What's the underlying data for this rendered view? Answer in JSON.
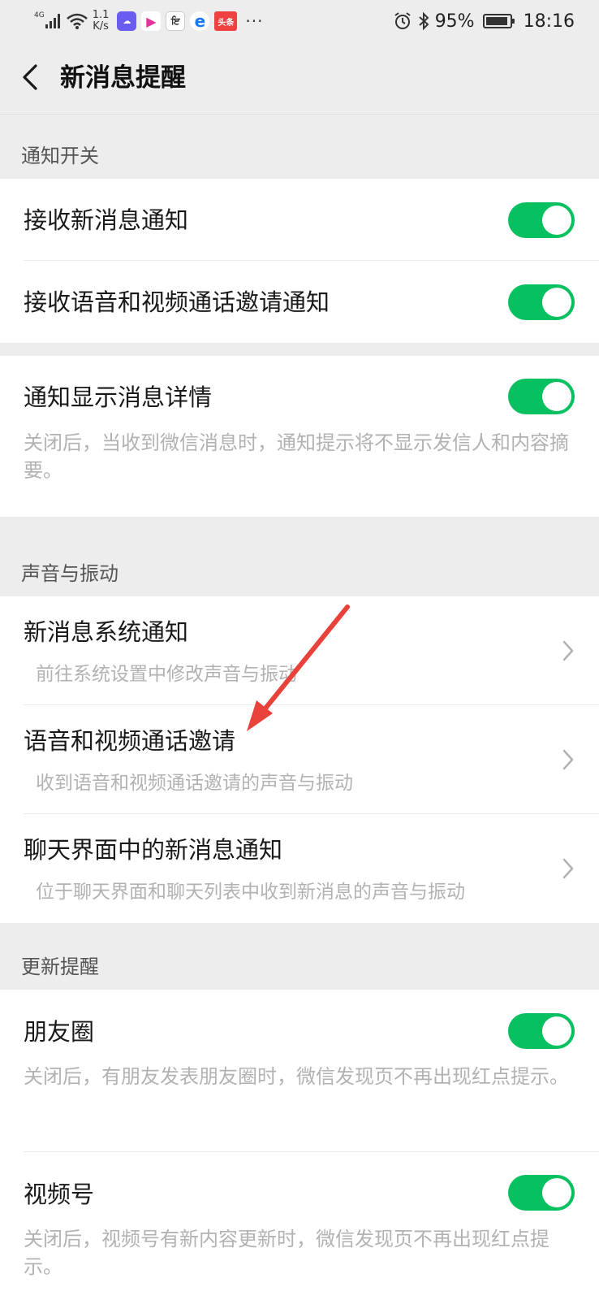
{
  "status_bar": {
    "network": "4G",
    "speed_value": "1.1",
    "speed_unit": "K/s",
    "app_icons": [
      {
        "name": "app-icon-cloud",
        "color": "#6a5cf0",
        "glyph": "☁"
      },
      {
        "name": "app-icon-play",
        "color": "#ffffff",
        "glyph": "▶"
      },
      {
        "name": "app-icon-news",
        "color": "#ffffff",
        "glyph": "ਇ"
      },
      {
        "name": "app-icon-browser",
        "color": "#1677ff",
        "glyph": "e"
      },
      {
        "name": "app-icon-toutiao",
        "color": "#f04142",
        "glyph": "头条"
      }
    ],
    "more": "···",
    "battery_percent": "95%",
    "battery_level": 0.95,
    "time": "18:16"
  },
  "navbar": {
    "title": "新消息提醒"
  },
  "sections": {
    "notify_switch": "通知开关",
    "sound_vibration": "声音与振动",
    "update_remind": "更新提醒"
  },
  "rows": {
    "receive_new": {
      "label": "接收新消息通知",
      "on": true
    },
    "receive_call": {
      "label": "接收语音和视频通话邀请通知",
      "on": true
    },
    "show_detail": {
      "label": "通知显示消息详情",
      "on": true,
      "desc": "关闭后，当收到微信消息时，通知提示将不显示发信人和内容摘要。"
    },
    "system_notify": {
      "label": "新消息系统通知",
      "desc": "前往系统设置中修改声音与振动"
    },
    "call_invite": {
      "label": "语音和视频通话邀请",
      "desc": "收到语音和视频通话邀请的声音与振动"
    },
    "chat_notify": {
      "label": "聊天界面中的新消息通知",
      "desc": "位于聊天界面和聊天列表中收到新消息的声音与振动"
    },
    "moments": {
      "label": "朋友圈",
      "on": true,
      "desc": "关闭后，有朋友发表朋友圈时，微信发现页不再出现红点提示。"
    },
    "channels": {
      "label": "视频号",
      "on": true,
      "desc": "关闭后，视频号有新内容更新时，微信发现页不再出现红点提示。"
    }
  },
  "colors": {
    "accent": "#07c160",
    "annotation_arrow": "#e8423a"
  }
}
